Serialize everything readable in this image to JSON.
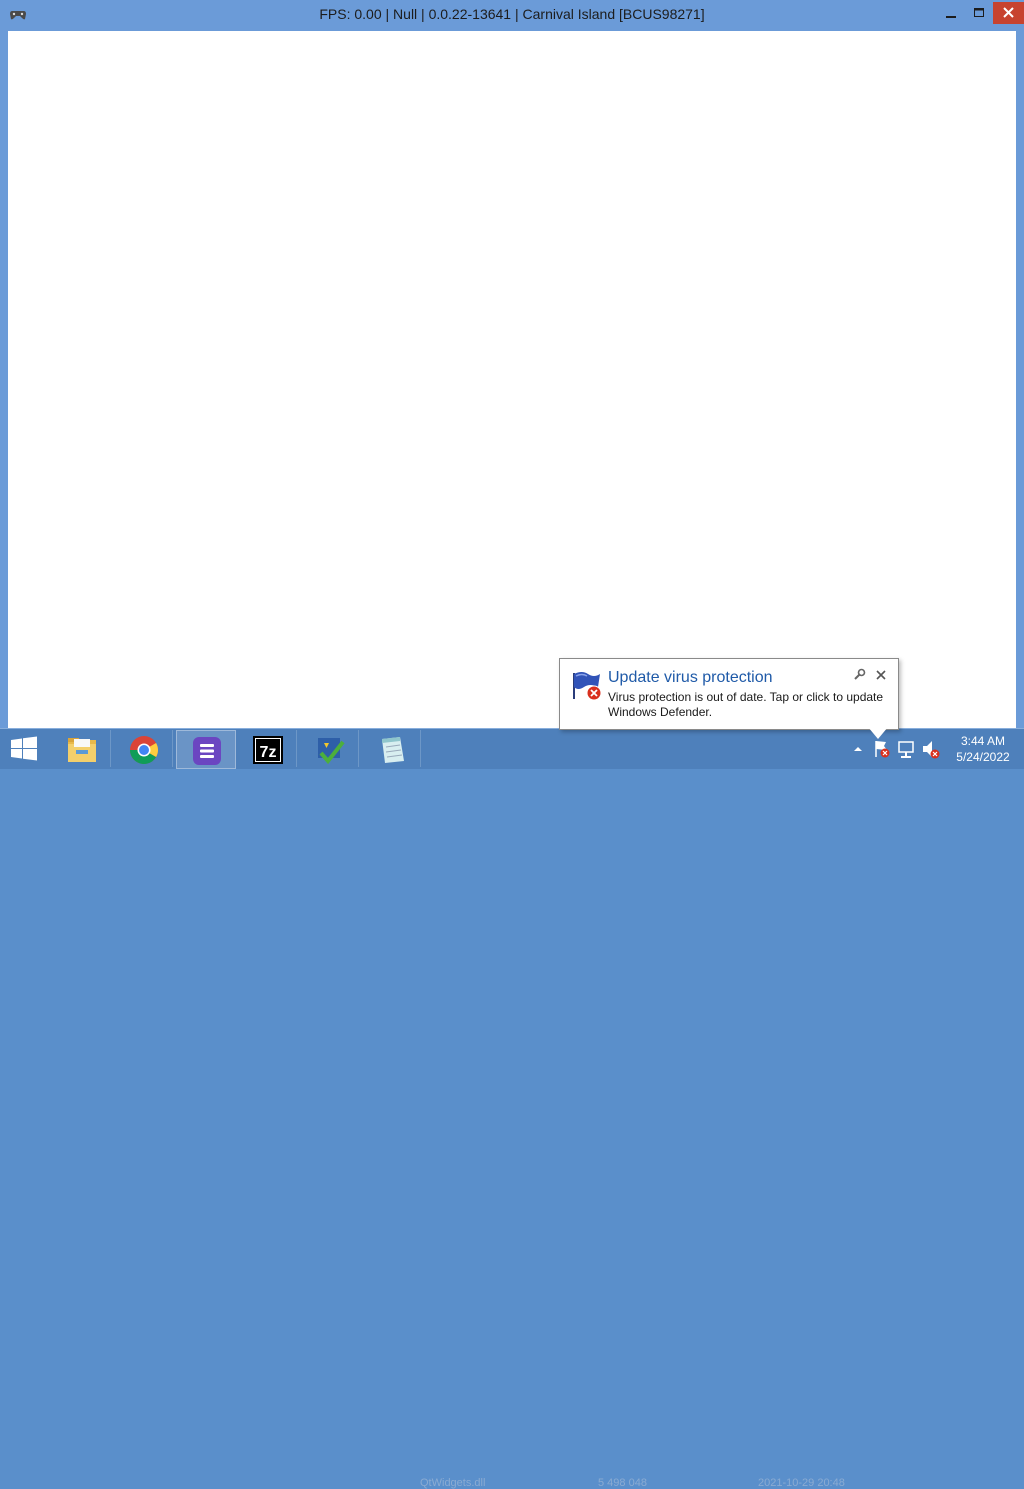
{
  "window": {
    "title": "FPS: 0.00 | Null | 0.0.22-13641 | Carnival Island [BCUS98271]",
    "controls": {
      "minimize": "minimize",
      "maximize": "maximize",
      "close": "close"
    }
  },
  "taskbar": {
    "pinned": [
      {
        "name": "file-explorer",
        "icon": "folder-icon"
      },
      {
        "name": "google-chrome",
        "icon": "chrome-icon"
      },
      {
        "name": "rpcs3-app",
        "icon": "app-b-icon"
      },
      {
        "name": "7zip",
        "icon": "7zip-icon"
      },
      {
        "name": "check-tool",
        "icon": "checkmark-icon"
      },
      {
        "name": "notepad-tool",
        "icon": "notepad-icon"
      }
    ],
    "ghost_texts": [
      "QtWidgets.dll",
      "5 498 048",
      "2021-10-29 20:48"
    ],
    "clock": {
      "time": "3:44 AM",
      "date": "5/24/2022"
    }
  },
  "balloon": {
    "title": "Update virus protection",
    "message": "Virus protection is out of date. Tap or click to update Windows Defender.",
    "icon": "defender-flag-error-icon"
  },
  "colors": {
    "titlebar": "#6b9bd8",
    "taskbar": "#4e80bb",
    "close_button": "#c7432f",
    "balloon_title": "#1f5aa8"
  }
}
